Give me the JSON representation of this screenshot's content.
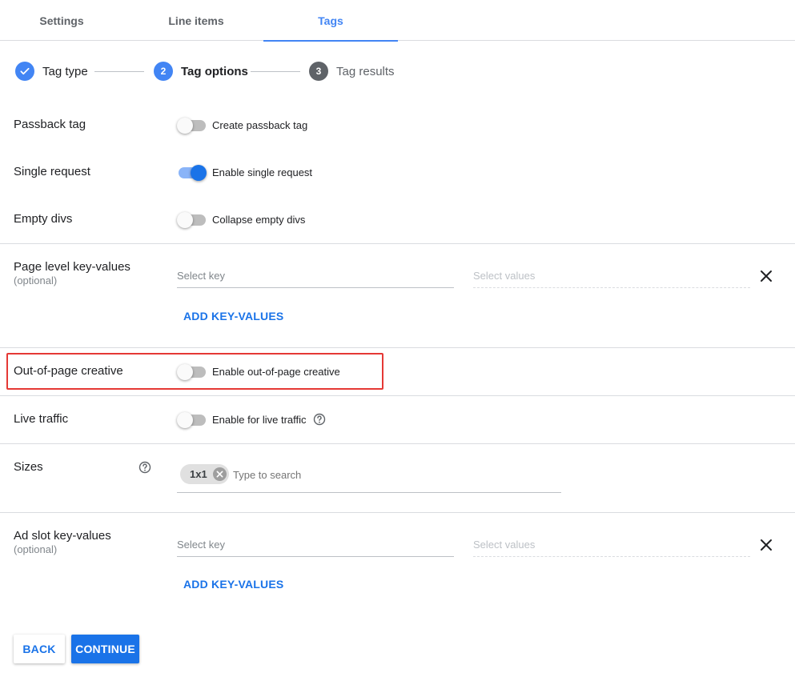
{
  "tabs": [
    {
      "label": "Settings"
    },
    {
      "label": "Line items"
    },
    {
      "label": "Tags"
    }
  ],
  "stepper": {
    "steps": [
      {
        "number": "",
        "label": "Tag type",
        "state": "done"
      },
      {
        "number": "2",
        "label": "Tag options",
        "state": "current"
      },
      {
        "number": "3",
        "label": "Tag results",
        "state": "pending"
      }
    ]
  },
  "passback": {
    "label": "Passback tag",
    "toggle_label": "Create passback tag",
    "enabled": false
  },
  "single_request": {
    "label": "Single request",
    "toggle_label": "Enable single request",
    "enabled": true
  },
  "empty_divs": {
    "label": "Empty divs",
    "toggle_label": "Collapse empty divs",
    "enabled": false
  },
  "page_kv": {
    "label": "Page level key-values",
    "sublabel": "(optional)",
    "key_placeholder": "Select key",
    "values_placeholder": "Select values",
    "add_label": "ADD KEY-VALUES"
  },
  "out_of_page": {
    "label": "Out-of-page creative",
    "toggle_label": "Enable out-of-page creative",
    "enabled": false
  },
  "live_traffic": {
    "label": "Live traffic",
    "toggle_label": "Enable for live traffic",
    "enabled": false
  },
  "sizes": {
    "label": "Sizes",
    "chips": [
      "1x1"
    ],
    "placeholder": "Type to search"
  },
  "slot_kv": {
    "label": "Ad slot key-values",
    "sublabel": "(optional)",
    "key_placeholder": "Select key",
    "values_placeholder": "Select values",
    "add_label": "ADD KEY-VALUES"
  },
  "footer": {
    "back_label": "BACK",
    "continue_label": "CONTINUE"
  },
  "colors": {
    "accent": "#1a73e8",
    "step_blue": "#4285f4",
    "highlight": "#e53935"
  }
}
